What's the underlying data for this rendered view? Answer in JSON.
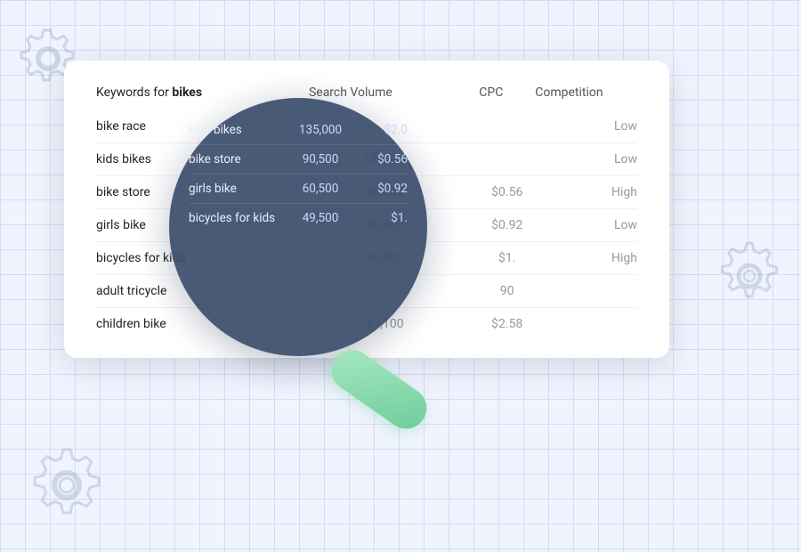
{
  "background": {
    "gridColor": "#b8c8e8"
  },
  "card": {
    "header": {
      "keyword_prefix": "Keywords for ",
      "keyword_bold": "bikes",
      "col_volume": "Search Volume",
      "col_cpc": "CPC",
      "col_competition": "Competition"
    },
    "rows": [
      {
        "keyword": "bike race",
        "volume": "",
        "cpc": "",
        "competition": "Low"
      },
      {
        "keyword": "kids bikes",
        "volume": "135,000",
        "cpc": "",
        "competition": "Low"
      },
      {
        "keyword": "bike store",
        "volume": "90,500",
        "cpc": "$0.56",
        "competition": "High"
      },
      {
        "keyword": "girls bike",
        "volume": "60,500",
        "cpc": "$0.92",
        "competition": "Low"
      },
      {
        "keyword": "bicycles for kids",
        "volume": "49,500",
        "cpc": "$1.",
        "competition": "High"
      },
      {
        "keyword": "adult tricycle",
        "volume": "",
        "cpc": "90",
        "competition": ""
      },
      {
        "keyword": "children bike",
        "volume": "27,100",
        "cpc": "$2.58",
        "competition": ""
      }
    ]
  },
  "magnifier": {
    "rows": [
      {
        "keyword": "kids bikes",
        "volume": "135,000",
        "cpc": "$2.0"
      },
      {
        "keyword": "bike store",
        "volume": "90,500",
        "cpc": "$0.56"
      },
      {
        "keyword": "girls bike",
        "volume": "60,500",
        "cpc": "$0.92"
      },
      {
        "keyword": "bicycles for kids",
        "volume": "49,500",
        "cpc": "$1."
      }
    ]
  },
  "icons": {
    "gear": "⚙"
  }
}
